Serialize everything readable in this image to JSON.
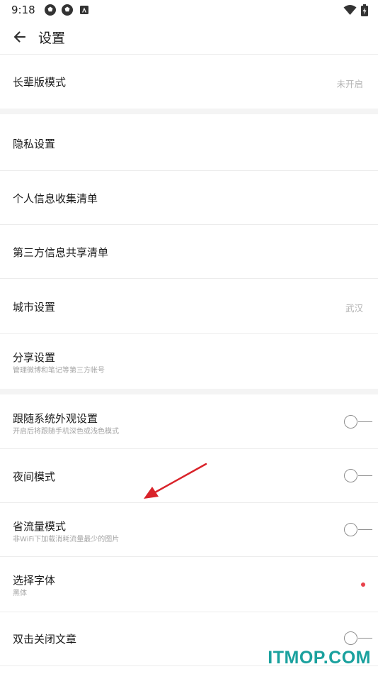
{
  "status_bar": {
    "time": "9:18",
    "icons": [
      "soccer-ball-icon",
      "soccer-ball-icon",
      "app-a-icon"
    ],
    "right_icons": [
      "wifi-icon",
      "battery-charging-icon"
    ]
  },
  "app_bar": {
    "back_icon": "arrow-left-icon",
    "title": "设置"
  },
  "rows": {
    "elder_mode": {
      "label": "长辈版模式",
      "value": "未开启"
    },
    "privacy": {
      "label": "隐私设置"
    },
    "personal_info_list": {
      "label": "个人信息收集清单"
    },
    "third_party_list": {
      "label": "第三方信息共享清单"
    },
    "city": {
      "label": "城市设置",
      "value": "武汉"
    },
    "share": {
      "label": "分享设置",
      "sub": "管理微博和笔记等第三方帐号"
    },
    "follow_system": {
      "label": "跟随系统外观设置",
      "sub": "开启后将跟随手机深色或浅色模式",
      "on": false
    },
    "night_mode": {
      "label": "夜间模式",
      "on": false
    },
    "data_saver": {
      "label": "省流量模式",
      "sub": "非WiFi下加载消耗流量最少的图片",
      "on": false
    },
    "font": {
      "label": "选择字体",
      "sub": "黑体"
    },
    "double_tap_close": {
      "label": "双击关闭文章",
      "on": false
    }
  },
  "colors": {
    "accent_dot": "#e8414b",
    "watermark": "#1aa19e",
    "annotation_arrow": "#d9232a"
  },
  "watermark": "ITMOP.COM"
}
